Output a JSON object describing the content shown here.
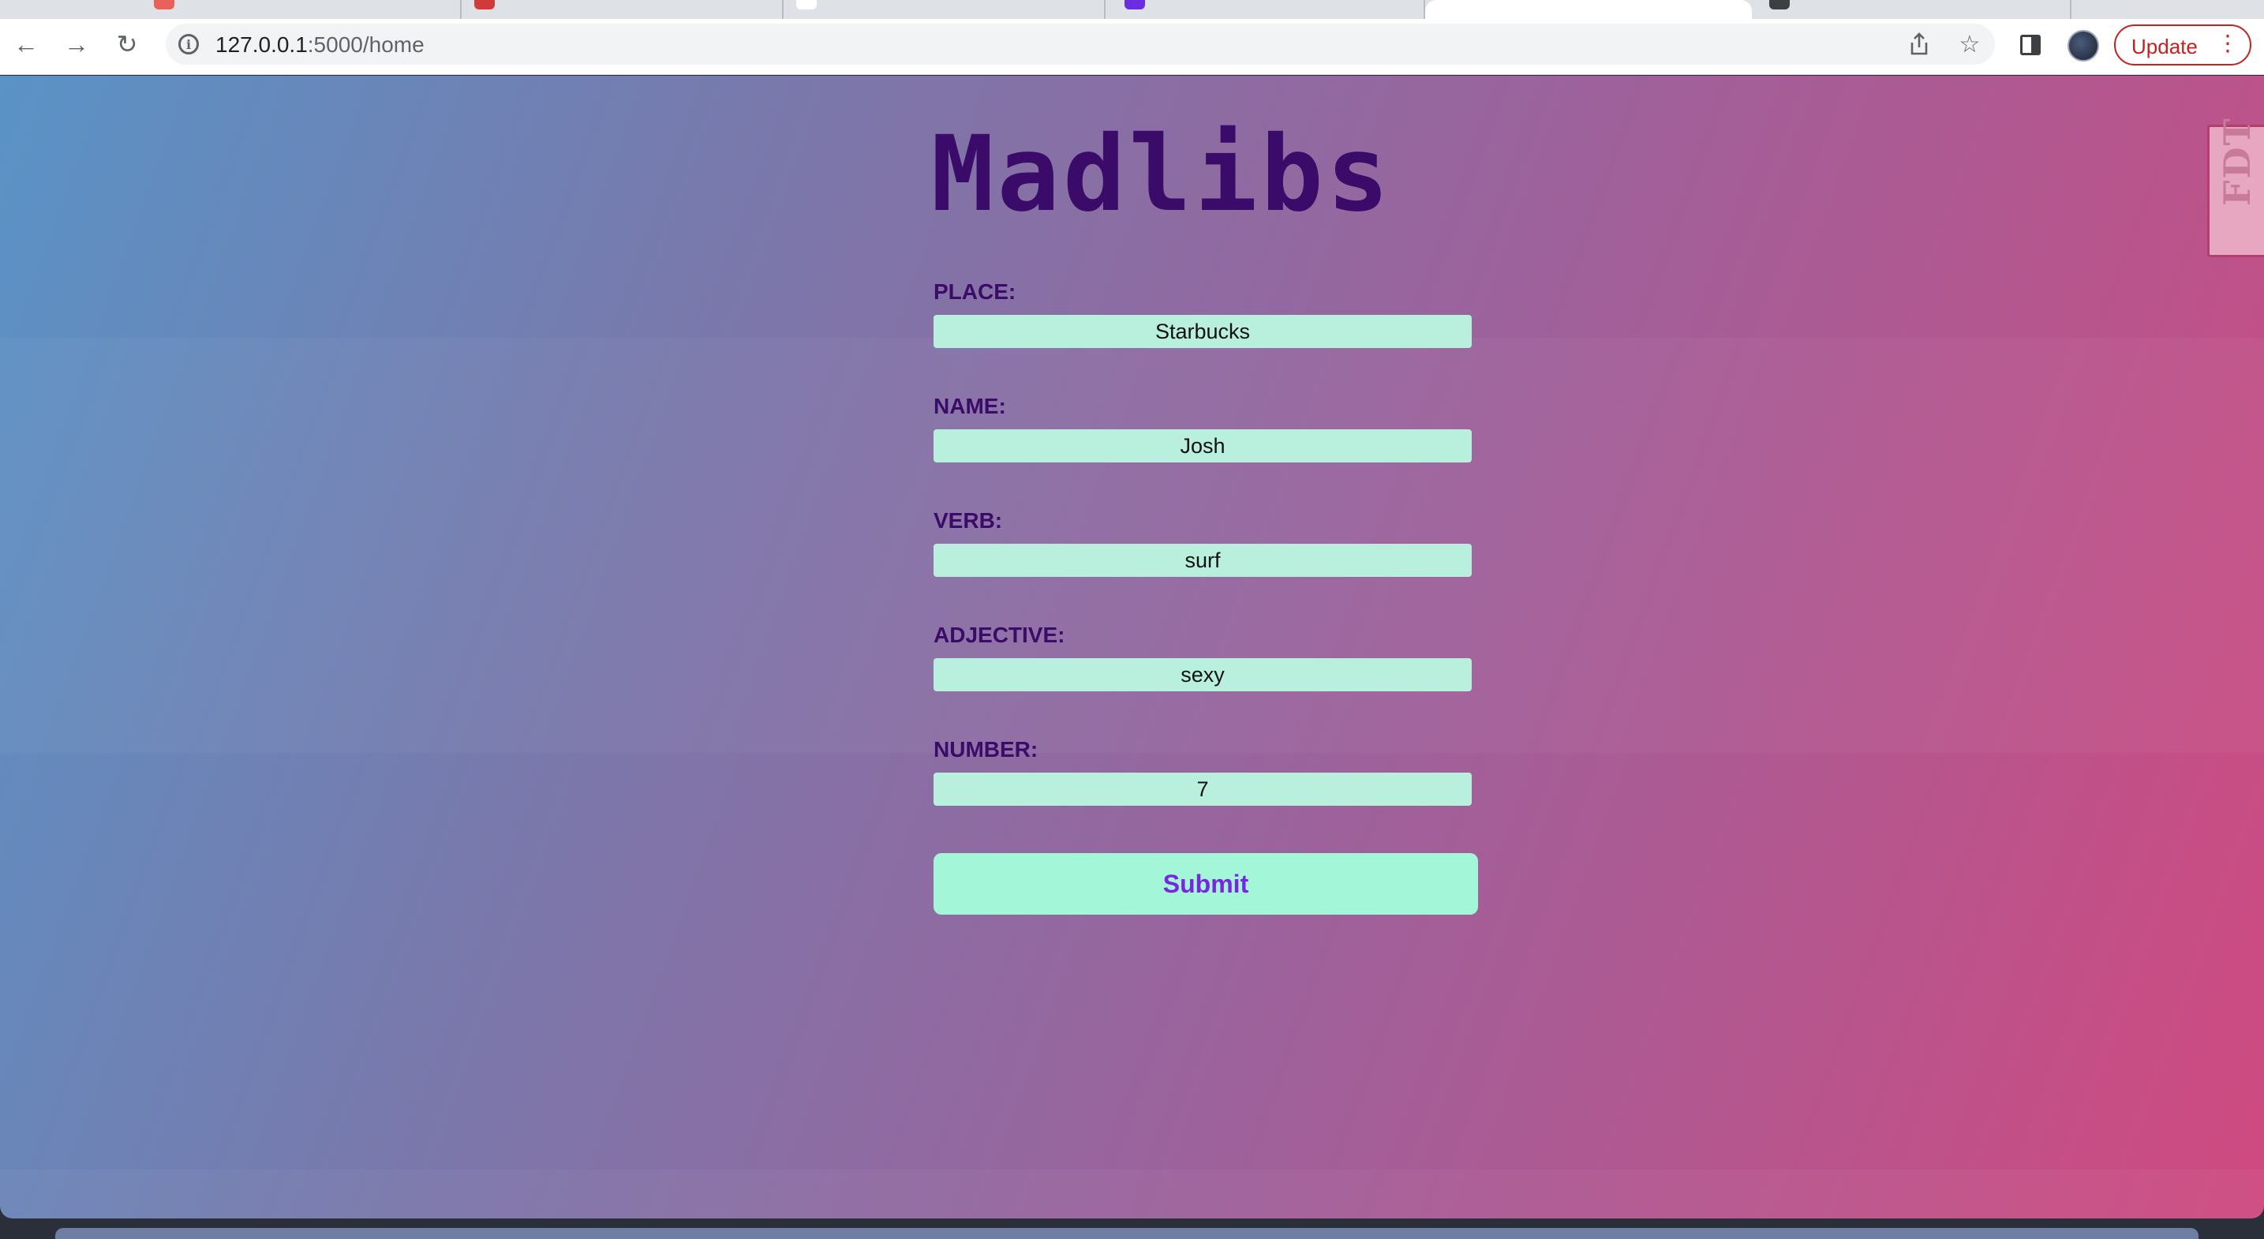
{
  "browser": {
    "url_host": "127.0.0.1",
    "url_path": ":5000/home",
    "update_label": "Update",
    "menu_glyph": "⋮"
  },
  "page": {
    "title": "Madlibs",
    "fdt_label": "FDT",
    "fields": [
      {
        "label": "PLACE:",
        "value": "Starbucks"
      },
      {
        "label": "NAME:",
        "value": "Josh"
      },
      {
        "label": "VERB:",
        "value": "surf"
      },
      {
        "label": "ADJECTIVE:",
        "value": "sexy"
      },
      {
        "label": "NUMBER:",
        "value": "7"
      }
    ],
    "submit_label": "Submit"
  },
  "colors": {
    "title": "#3a0b68",
    "input_bg": "#b9f0dd",
    "submit_bg": "#a3f7d8",
    "submit_text": "#7a25e0",
    "update_red": "#c5221f"
  },
  "icons": [
    "back-icon",
    "forward-icon",
    "reload-icon",
    "site-info-icon",
    "share-icon",
    "bookmark-star-icon",
    "side-panel-icon",
    "profile-avatar",
    "more-menu-icon"
  ]
}
